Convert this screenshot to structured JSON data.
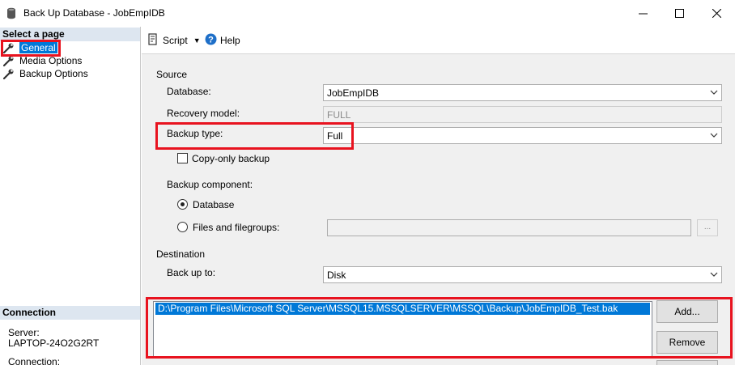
{
  "window": {
    "title": "Back Up Database - JobEmpIDB",
    "minimize_icon": "minimize-icon",
    "maximize_icon": "maximize-icon",
    "close_icon": "close-icon"
  },
  "left_pane": {
    "select_page_header": "Select a page",
    "pages": [
      {
        "label": "General",
        "icon": "wrench-icon",
        "selected": true
      },
      {
        "label": "Media Options",
        "icon": "wrench-icon",
        "selected": false
      },
      {
        "label": "Backup Options",
        "icon": "wrench-icon",
        "selected": false
      }
    ],
    "connection_header": "Connection",
    "server_label": "Server:",
    "server_value": "LAPTOP-24O2G2RT",
    "connection_label": "Connection:"
  },
  "toolbar": {
    "script_label": "Script",
    "help_label": "Help"
  },
  "source": {
    "section_label": "Source",
    "database_label": "Database:",
    "database_value": "JobEmpIDB",
    "recovery_model_label": "Recovery model:",
    "recovery_model_value": "FULL",
    "backup_type_label": "Backup type:",
    "backup_type_value": "Full",
    "copy_only_label": "Copy-only backup",
    "copy_only_checked": false,
    "backup_component_label": "Backup component:",
    "component_database_label": "Database",
    "component_files_label": "Files and filegroups:",
    "browse_button_label": "..."
  },
  "destination": {
    "section_label": "Destination",
    "back_up_to_label": "Back up to:",
    "back_up_to_value": "Disk",
    "paths": [
      "D:\\Program Files\\Microsoft SQL Server\\MSSQL15.MSSQLSERVER\\MSSQL\\Backup\\JobEmpIDB_Test.bak"
    ],
    "add_button_label": "Add...",
    "remove_button_label": "Remove"
  },
  "colors": {
    "highlight": "#e8131f",
    "selection": "#0078d7",
    "header_bg": "#dde6f0"
  }
}
